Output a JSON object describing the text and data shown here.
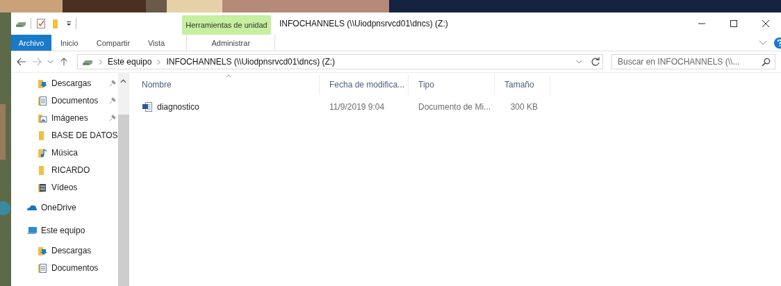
{
  "window": {
    "title": "INFOCHANNELS (\\\\Uiodpnsrvcd01\\dncs) (Z:)",
    "context_group": "Herramientas de unidad"
  },
  "ribbon_tabs": [
    {
      "label": "Archivo",
      "kind": "file"
    },
    {
      "label": "Inicio",
      "kind": "normal"
    },
    {
      "label": "Compartir",
      "kind": "normal"
    },
    {
      "label": "Vista",
      "kind": "normal"
    },
    {
      "label": "Administrar",
      "kind": "context"
    }
  ],
  "address": {
    "path": [
      "Este equipo",
      "INFOCHANNELS (\\\\Uiodpnsrvcd01\\dncs) (Z:)"
    ]
  },
  "search": {
    "placeholder": "Buscar en INFOCHANNELS (\\\\..."
  },
  "sidebar": {
    "quick_access": [
      {
        "label": "Descargas",
        "kind": "download",
        "pinned": true
      },
      {
        "label": "Documentos",
        "kind": "document",
        "pinned": true
      },
      {
        "label": "Imágenes",
        "kind": "pictures",
        "pinned": true
      },
      {
        "label": "BASE DE DATOS",
        "kind": "folder",
        "pinned": false
      },
      {
        "label": "Música",
        "kind": "music",
        "pinned": false
      },
      {
        "label": "RICARDO",
        "kind": "folder",
        "pinned": false
      },
      {
        "label": "Vídeos",
        "kind": "video",
        "pinned": false
      }
    ],
    "items": [
      {
        "label": "OneDrive",
        "kind": "cloud"
      },
      {
        "label": "Este equipo",
        "kind": "pc",
        "children": [
          {
            "label": "Descargas",
            "kind": "download"
          },
          {
            "label": "Documentos",
            "kind": "document"
          }
        ]
      }
    ]
  },
  "table": {
    "columns": [
      {
        "label": "Nombre",
        "sorted": true
      },
      {
        "label": "Fecha de modifica...",
        "sorted": false
      },
      {
        "label": "Tipo",
        "sorted": false
      },
      {
        "label": "Tamaño",
        "sorted": false
      }
    ],
    "rows": [
      {
        "name": "diagnostico",
        "date": "11/9/2019 9:04",
        "type": "Documento de Mi...",
        "size": "300 KB"
      }
    ]
  }
}
